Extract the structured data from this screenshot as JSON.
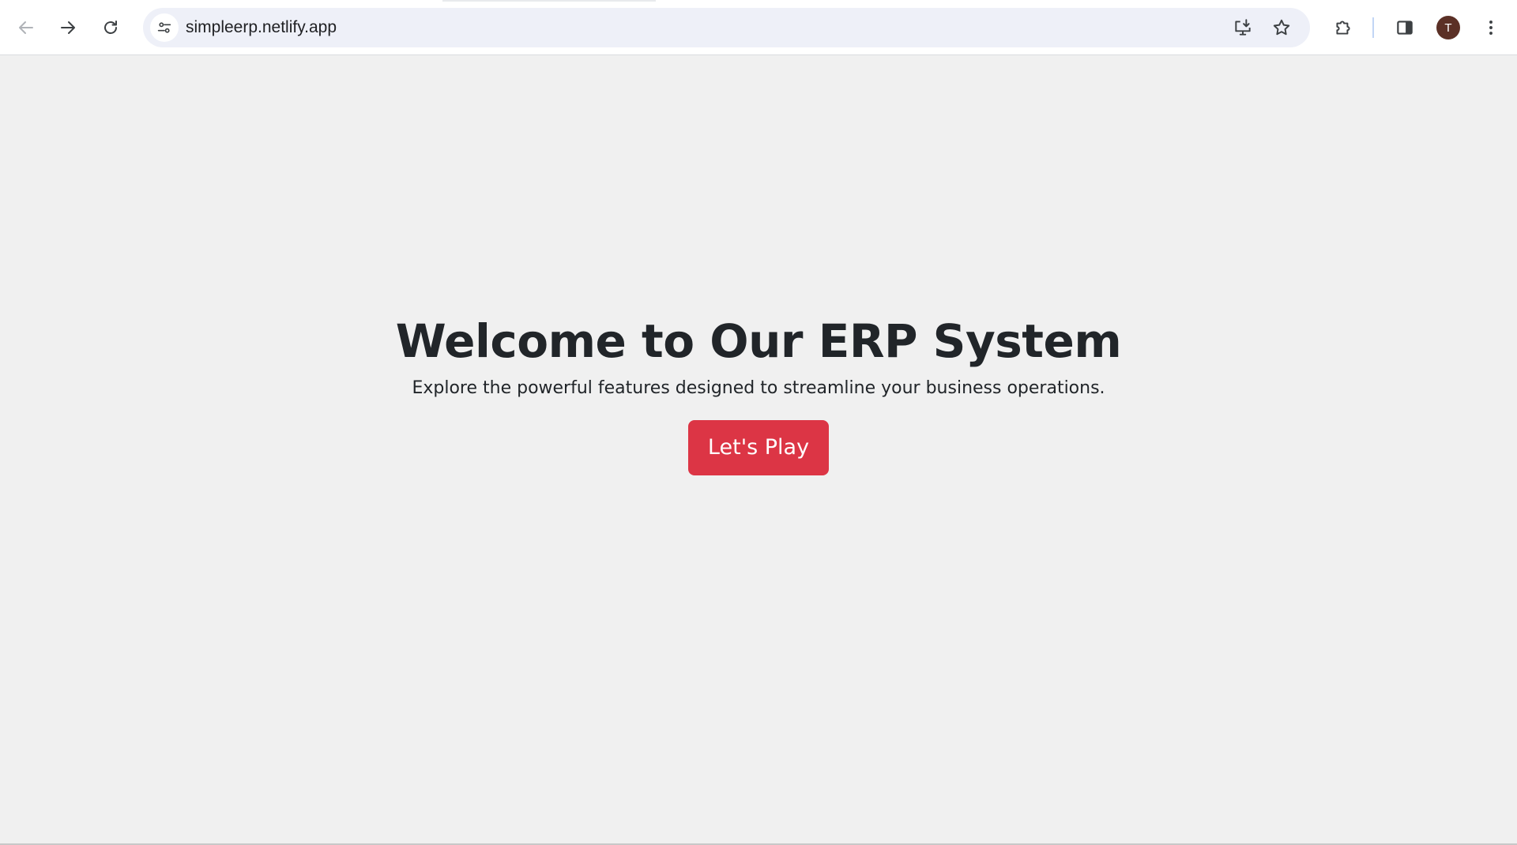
{
  "browser": {
    "url": "simpleerp.netlify.app",
    "profile_initial": "T"
  },
  "hero": {
    "title": "Welcome to Our ERP System",
    "subtitle": "Explore the powerful features designed to streamline your business operations.",
    "cta_label": "Let's Play"
  },
  "colors": {
    "cta_background": "#dc3545",
    "page_background": "#f0f0f0",
    "text": "#212529"
  },
  "icons": {
    "back": "arrow-left-icon",
    "forward": "arrow-right-icon",
    "reload": "reload-icon",
    "site_info": "tune-icon",
    "install": "install-app-icon",
    "bookmark": "star-icon",
    "extensions": "puzzle-icon",
    "side_panel": "side-panel-icon",
    "menu": "kebab-menu-icon"
  }
}
